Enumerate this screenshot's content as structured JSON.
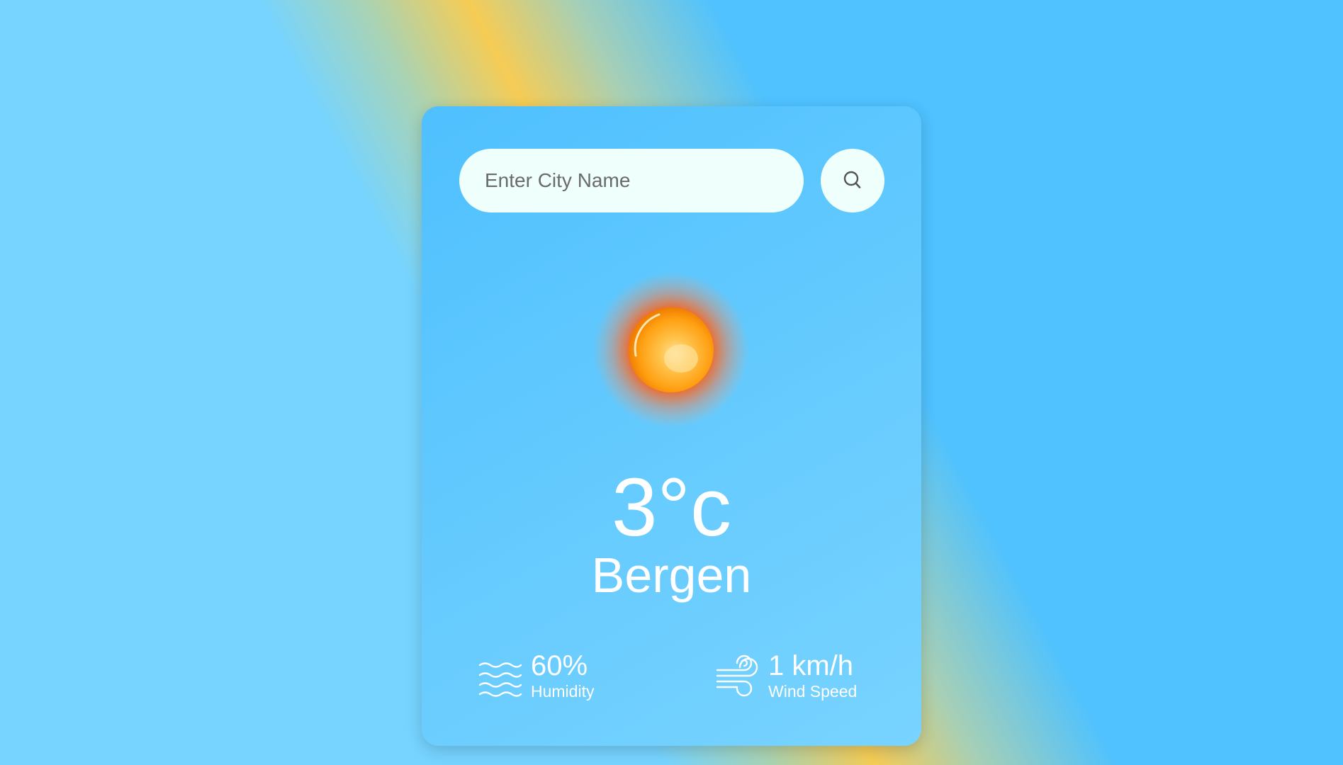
{
  "search": {
    "placeholder": "Enter City Name",
    "value": "",
    "button_icon": "search-icon"
  },
  "weather": {
    "condition_icon": "sun-icon",
    "temperature": "3°c",
    "city": "Bergen"
  },
  "details": {
    "humidity": {
      "icon": "humidity-icon",
      "value": "60%",
      "label": "Humidity"
    },
    "wind": {
      "icon": "wind-icon",
      "value": "1 km/h",
      "label": "Wind Speed"
    }
  },
  "colors": {
    "background_blue": "#4fc2ff",
    "background_light_blue": "#76d4ff",
    "background_yellow": "#f6cc55",
    "card_top": "#4fc0fe",
    "card_bottom": "#78d3ff",
    "input_background": "#effffb",
    "text": "#ffffff"
  }
}
